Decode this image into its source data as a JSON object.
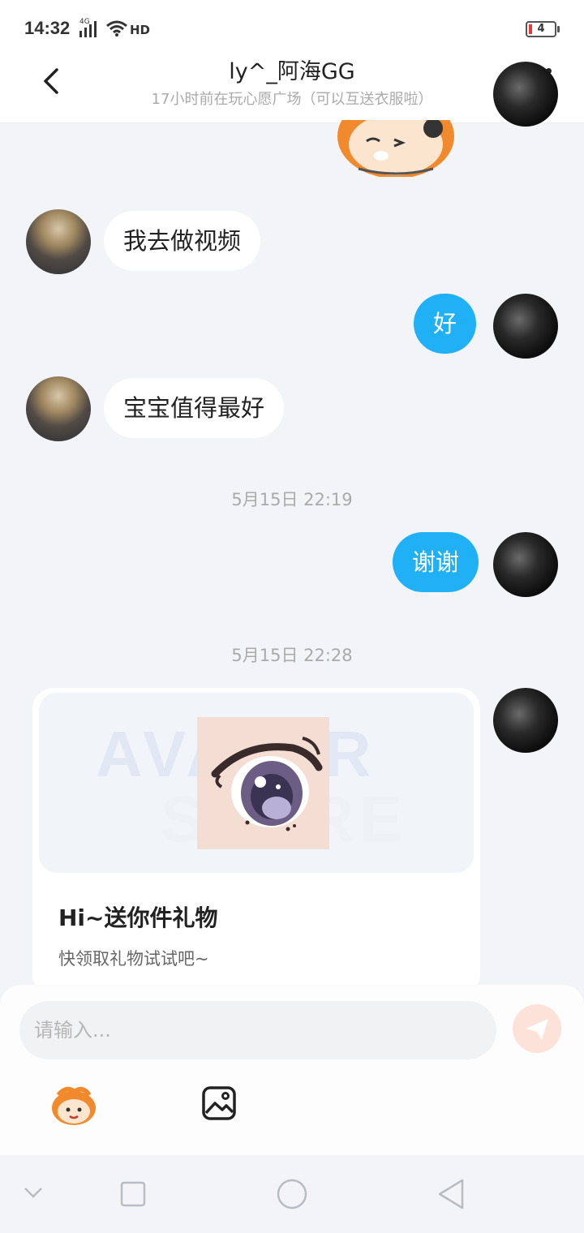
{
  "status_bar": {
    "time": "14:32",
    "network": "4G",
    "hd": "HD",
    "battery": "4",
    "battery_color": "#e53935"
  },
  "header": {
    "title": "ly^_阿海GG",
    "subtitle": "17小时前在玩心愿广场（可以互送衣服啦）"
  },
  "messages": [
    {
      "side": "in",
      "text": "我去做视频"
    },
    {
      "side": "out",
      "text": "好"
    },
    {
      "side": "in",
      "text": "宝宝值得最好"
    },
    {
      "type": "timestamp",
      "text": "5月15日 22:19"
    },
    {
      "side": "out",
      "text": "谢谢"
    },
    {
      "type": "timestamp",
      "text": "5月15日 22:28"
    }
  ],
  "gift_card": {
    "watermark_1": "AVATAR",
    "watermark_2": "STORE",
    "title": "Hi~送你件礼物",
    "description": "快领取礼物试试吧~"
  },
  "composer": {
    "placeholder": "请输入..."
  },
  "colors": {
    "outgoing_bubble": "#1fb0f5",
    "incoming_bubble": "#ffffff",
    "background": "#f3f4f8",
    "send_button": "#fde2d9"
  },
  "icons": [
    "back-arrow-icon",
    "more-vertical-icon",
    "emoji-icon",
    "image-icon",
    "send-icon",
    "nav-down-icon",
    "nav-recents-icon",
    "nav-home-icon",
    "nav-back-icon"
  ]
}
